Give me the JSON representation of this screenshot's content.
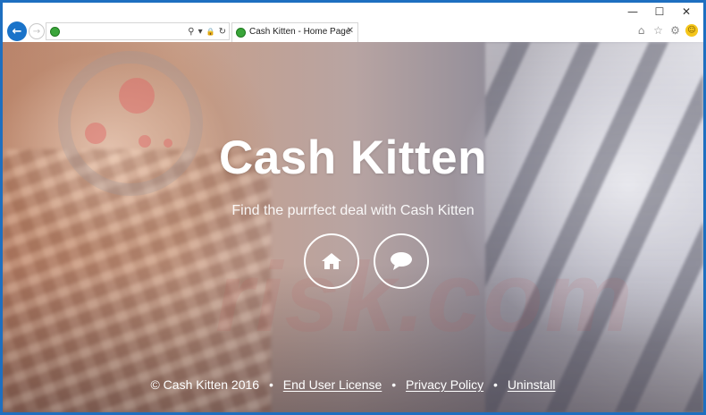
{
  "window": {
    "controls": {
      "minimize": "—",
      "maximize": "☐",
      "close": "✕"
    }
  },
  "navbar": {
    "back_icon": "←",
    "forward_icon": "→",
    "address_value": "",
    "address_tools": {
      "search": "⚲",
      "dropdown": "▾",
      "lock": "🔒",
      "refresh": "↻"
    },
    "tab": {
      "title": "Cash Kitten - Home Page",
      "close": "✕"
    },
    "right_tools": {
      "home": "⌂",
      "favorites": "☆",
      "settings": "⚙",
      "feedback": "☺"
    }
  },
  "page": {
    "title": "Cash Kitten",
    "subtitle": "Find the purrfect deal with Cash Kitten",
    "footer": {
      "copyright": "© Cash Kitten 2016",
      "separator": "•",
      "links": [
        "End User License",
        "Privacy Policy",
        "Uninstall"
      ]
    },
    "watermark": "risk.com"
  },
  "colors": {
    "window_border": "#1e6fc0",
    "back_button": "#1a73c9",
    "favicon": "#3aa53a",
    "hero_text": "#ffffff"
  }
}
